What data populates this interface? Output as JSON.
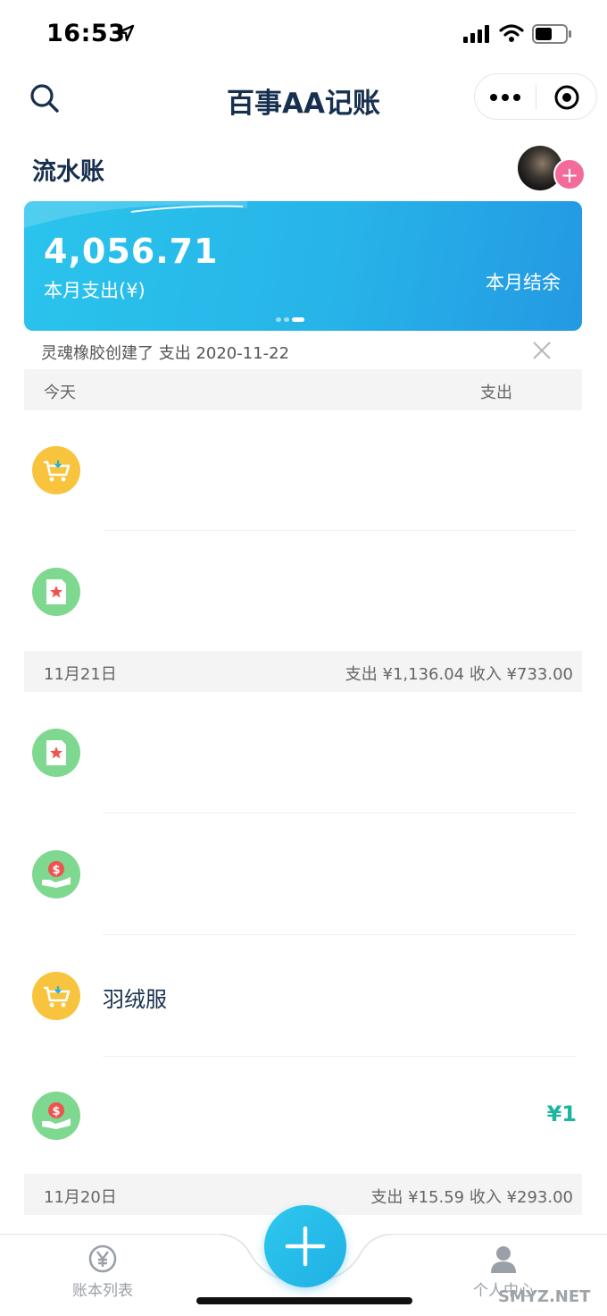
{
  "status_bar": {
    "time": "16:53"
  },
  "nav": {
    "title": "百事AA记账"
  },
  "section": {
    "title": "流水账"
  },
  "summary_card": {
    "expense_amount": "4,056.71",
    "expense_label": "本月支出(¥)",
    "balance_amount": "",
    "balance_label": "本月结余"
  },
  "notice": {
    "text": "灵魂橡胶创建了 支出  2020-11-22"
  },
  "days": [
    {
      "label": "今天",
      "summary": "支出",
      "transactions": [
        {
          "icon": "shopping-cart-icon",
          "name": "",
          "amount": "",
          "type": "expense"
        },
        {
          "icon": "star-document-icon",
          "name": "",
          "amount": "",
          "type": "expense"
        }
      ]
    },
    {
      "label": "11月21日",
      "summary": "支出 ¥1,136.04  收入 ¥733.00",
      "transactions": [
        {
          "icon": "star-document-icon",
          "name": "",
          "amount": "",
          "type": "expense"
        },
        {
          "icon": "money-hand-icon",
          "name": "",
          "amount": "",
          "type": "income"
        },
        {
          "icon": "shopping-cart-icon",
          "name": "羽绒服",
          "amount": "",
          "type": "expense"
        },
        {
          "icon": "money-hand-icon",
          "name": "",
          "amount": "¥1",
          "type": "income"
        }
      ]
    },
    {
      "label": "11月20日",
      "summary": "支出 ¥15.59  收入 ¥293.00",
      "transactions": []
    }
  ],
  "tab_bar": {
    "ledgers_label": "账本列表",
    "profile_label": "个人中心"
  },
  "watermark": "SMYZ.NET",
  "colors": {
    "accent": "#27b4e8",
    "title": "#17304f",
    "income": "#1bb6a0",
    "add_member": "#f26b9b",
    "icon_yellow": "#f8c43e",
    "icon_green": "#7fd88f"
  }
}
